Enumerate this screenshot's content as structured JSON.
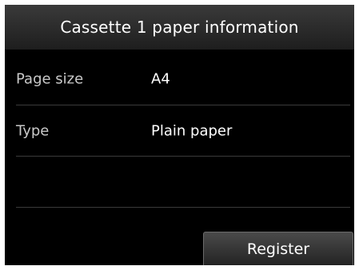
{
  "header": {
    "title": "Cassette 1 paper information"
  },
  "info_rows": [
    {
      "label": "Page size",
      "value": "A4"
    },
    {
      "label": "Type",
      "value": "Plain paper"
    }
  ],
  "actions": {
    "register_label": "Register"
  },
  "colors": {
    "screen_background": "#000000",
    "header_background": "#2a2a2a",
    "text_primary": "#ffffff",
    "text_secondary": "#c9c9c9"
  }
}
